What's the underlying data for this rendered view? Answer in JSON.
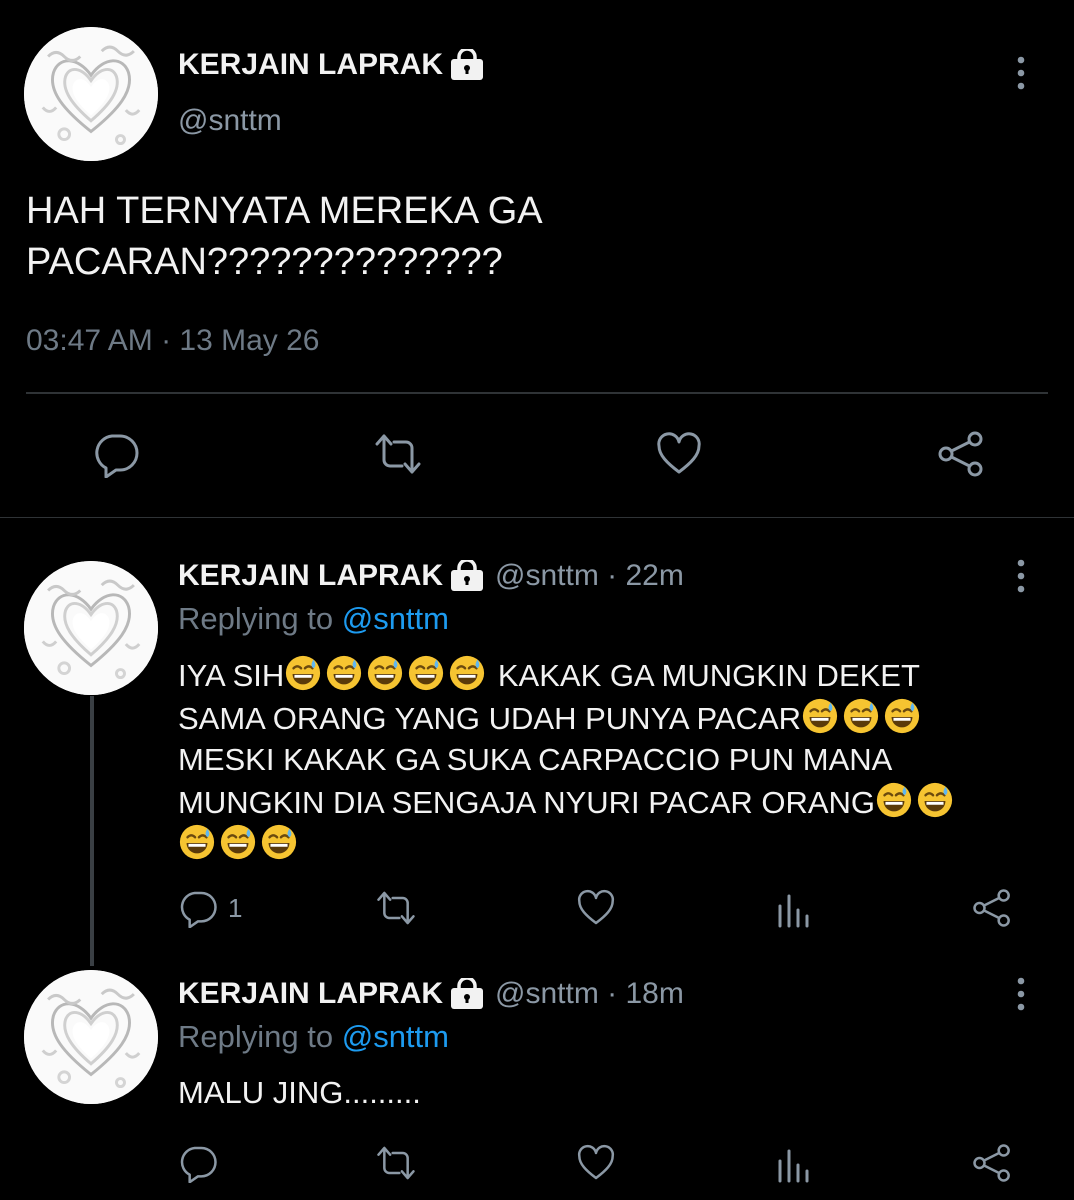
{
  "main_tweet": {
    "name": "KERJAIN LAPRAK",
    "handle": "@snttm",
    "text_line1": "HAH TERNYATA MEREKA GA",
    "text_line2": "PACARAN??????????????",
    "timestamp": "03:47 AM · 13 May 26",
    "actions": [
      "comment-icon",
      "retweet-icon",
      "heart-icon",
      "share-icon"
    ]
  },
  "replies": [
    {
      "name": "KERJAIN LAPRAK",
      "handle_time": "@snttm · 22m",
      "replying_prefix": "Replying to ",
      "replying_to": "@snttm",
      "line1_a": "IYA SIH",
      "line1_b": " KAKAK GA MUNGKIN DEKET",
      "line2": "SAMA ORANG YANG UDAH PUNYA PACAR",
      "line3": "MESKI KAKAK GA SUKA CARPACCIO PUN MANA",
      "line4": "MUNGKIN DIA SENGAJA NYURI PACAR ORANG",
      "reply_count": "1",
      "emoji": "grinning-face-with-sweat"
    },
    {
      "name": "KERJAIN LAPRAK",
      "handle_time": "@snttm · 18m",
      "replying_prefix": "Replying to ",
      "replying_to": "@snttm",
      "text": "MALU JING.........",
      "reply_count": ""
    }
  ],
  "colors": {
    "background": "#000000",
    "text": "#f2f2f2",
    "muted": "#8b98a5",
    "link": "#1d9bf0",
    "divider": "#2f3336"
  }
}
